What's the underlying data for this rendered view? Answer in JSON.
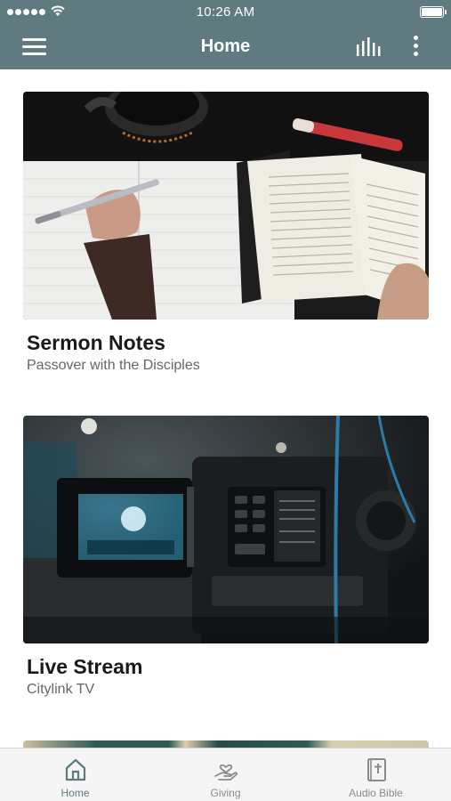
{
  "status_bar": {
    "time": "10:26 AM"
  },
  "header": {
    "title": "Home",
    "menu_icon": "hamburger-menu-icon",
    "audio_icon": "audio-equalizer-icon",
    "more_icon": "vertical-ellipsis-icon"
  },
  "cards": [
    {
      "title": "Sermon Notes",
      "subtitle": "Passover with the Disciples",
      "image": "notebook-and-bible-photo"
    },
    {
      "title": "Live Stream",
      "subtitle": "Citylink TV",
      "image": "video-camera-photo"
    }
  ],
  "tabs": [
    {
      "label": "Home",
      "icon": "home-icon",
      "active": true
    },
    {
      "label": "Giving",
      "icon": "giving-hand-heart-icon",
      "active": false
    },
    {
      "label": "Audio Bible",
      "icon": "bible-icon",
      "active": false
    }
  ],
  "colors": {
    "header_bg": "#5f7b80",
    "accent": "#5f7b80",
    "tab_bar_bg": "#f5f5f5",
    "inactive_tab": "#8a8a8a"
  }
}
